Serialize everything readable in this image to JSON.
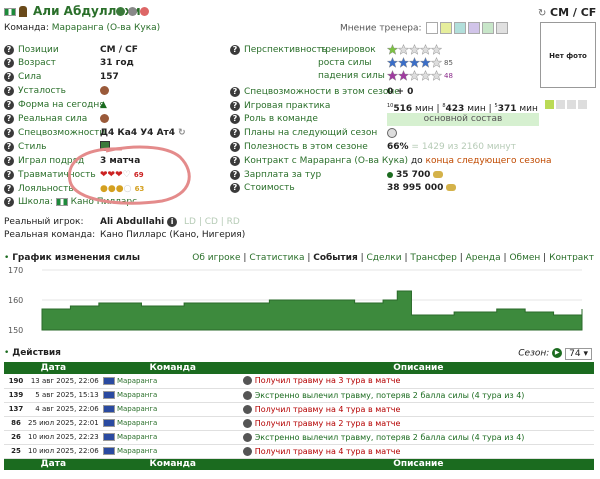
{
  "player": {
    "name": "Али Абдуллахи",
    "team_prefix": "Команда:",
    "team": "Мараранга (О-ва Кука)",
    "position_header": "CM / CF"
  },
  "coach": {
    "label": "Мнение тренера:",
    "colors": [
      "#ffffff",
      "#e6ee9c",
      "#b2dfdb",
      "#d1c4e9",
      "#c8e6c9",
      "#e0e0e0"
    ]
  },
  "photo": {
    "text": "Нет фото"
  },
  "left": [
    {
      "label": "Позиции",
      "value": "CM / CF"
    },
    {
      "label": "Возраст",
      "value": "31 год"
    },
    {
      "label": "Сила",
      "value": "157"
    },
    {
      "label": "Усталость",
      "value": ""
    },
    {
      "label": "Форма на сегодня",
      "value": ""
    },
    {
      "label": "Реальная сила",
      "value": ""
    },
    {
      "label": "Спецвозможности",
      "value": "Д4 Ка4 У4 Ат4"
    },
    {
      "label": "Стиль",
      "value": ""
    },
    {
      "label": "Играл подряд",
      "value": "3 матча"
    },
    {
      "label": "Травматичность",
      "value": "69"
    },
    {
      "label": "Лояльность",
      "value": "63"
    }
  ],
  "school": {
    "label": "Школа:",
    "value": "Кано Пилларс"
  },
  "right": {
    "prospect": "Перспективность",
    "training": "тренировок",
    "growth": "роста силы",
    "growth_val": "85",
    "fall": "падения силы",
    "fall_val": "48",
    "spec_season": "Спецвозможности в этом сезоне",
    "spec_season_val": "0 + 0",
    "practice": "Игровая практика",
    "practice_1": "516",
    "practice_2": "423",
    "practice_3": "371",
    "min": "мин",
    "sup1": "10",
    "sup2": "8",
    "sup3": "5",
    "role": "Роль в команде",
    "role_val": "основной состав",
    "plans": "Планы на следующий сезон",
    "useful": "Полезность в этом сезоне",
    "useful_pct": "66%",
    "useful_rest": "= 1429 из 2160 минут",
    "contract": "Контракт с",
    "contract_team": "Мараранга (О-ва Кука)",
    "contract_to": "до",
    "contract_end": "конца следующего сезона",
    "salary": "Зарплата за тур",
    "salary_val": "35 700",
    "cost": "Стоимость",
    "cost_val": "38 995 000"
  },
  "real": {
    "player_label": "Реальный игрок:",
    "player": "Ali Abdullahi",
    "links": "LD | CD | RD",
    "team_label": "Реальная команда:",
    "team": "Кано Пилларс (Кано, Нигерия)"
  },
  "chart_section": {
    "title": "График изменения силы",
    "nav": [
      "Об игроке",
      "Статистика",
      "События",
      "Сделки",
      "Трансфер",
      "Аренда",
      "Обмен",
      "Контракт"
    ]
  },
  "chart_data": {
    "type": "area",
    "ylim": [
      150,
      170
    ],
    "yticks": [
      "170",
      "160",
      "150"
    ],
    "values": [
      157,
      157,
      158,
      158,
      159,
      159,
      159,
      158,
      158,
      158,
      159,
      159,
      159,
      159,
      159,
      159,
      160,
      160,
      160,
      160,
      160,
      160,
      159,
      159,
      160,
      163,
      155,
      155,
      155,
      156,
      156,
      156,
      157,
      157,
      156,
      156,
      155,
      155,
      157
    ]
  },
  "actions": {
    "title": "Действия",
    "season_label": "Сезон:",
    "season": "74",
    "headers": [
      "Дата",
      "Команда",
      "Описание"
    ],
    "rows": [
      {
        "n": "190",
        "date": "13 авг 2025, 22:06",
        "team": "Мараранга",
        "desc": "Получил травму на 3 тура в матче",
        "type": "red"
      },
      {
        "n": "139",
        "date": "5 авг 2025, 15:13",
        "team": "Мараранга",
        "desc": "Экстренно вылечил травму, потеряв 2 балла силы (4 тура из 4)",
        "type": "grn"
      },
      {
        "n": "137",
        "date": "4 авг 2025, 22:06",
        "team": "Мараранга",
        "desc": "Получил травму на 4 тура в матче",
        "type": "red"
      },
      {
        "n": "86",
        "date": "25 июл 2025, 22:01",
        "team": "Мараранга",
        "desc": "Получил травму на 2 тура в матче",
        "type": "red"
      },
      {
        "n": "26",
        "date": "10 июл 2025, 22:23",
        "team": "Мараранга",
        "desc": "Экстренно вылечил травму, потеряв 2 балла силы (4 тура из 4)",
        "type": "grn"
      },
      {
        "n": "25",
        "date": "10 июл 2025, 22:06",
        "team": "Мараранга",
        "desc": "Получил травму на 4 тура в матче",
        "type": "red"
      }
    ]
  }
}
